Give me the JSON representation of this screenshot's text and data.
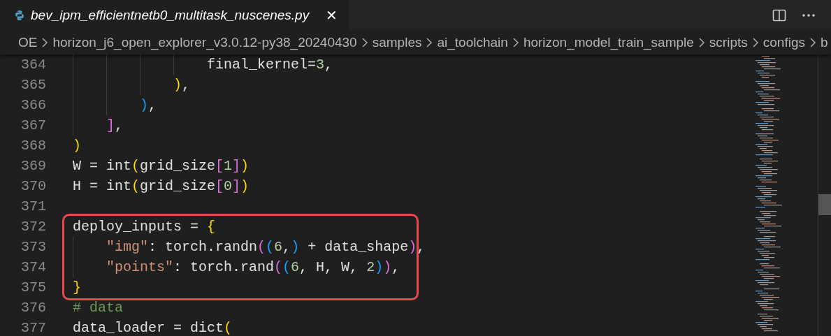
{
  "tab": {
    "title": "bev_ipm_efficientnetb0_multitask_nuscenes.py",
    "close": "✕",
    "selected": true
  },
  "breadcrumb": [
    "OE",
    "horizon_j6_open_explorer_v3.0.12-py38_20240430",
    "samples",
    "ai_toolchain",
    "horizon_model_train_sample",
    "scripts",
    "configs",
    "b"
  ],
  "code": {
    "sections": [
      {
        "kind": "plain",
        "lines": [
          {
            "number": "364",
            "tokens": [
              {
                "kind": "text",
                "text": "                final_kernel="
              },
              {
                "kind": "num",
                "text": "3"
              },
              {
                "kind": "text",
                "text": ","
              }
            ]
          },
          {
            "number": "365",
            "tokens": [
              {
                "kind": "b1",
                "text": "            )"
              },
              {
                "kind": "text",
                "text": ","
              }
            ]
          },
          {
            "number": "366",
            "tokens": [
              {
                "kind": "b3",
                "text": "        )"
              },
              {
                "kind": "text",
                "text": ","
              }
            ]
          },
          {
            "number": "367",
            "tokens": [
              {
                "kind": "b2",
                "text": "    ]"
              },
              {
                "kind": "text",
                "text": ","
              }
            ]
          },
          {
            "number": "368",
            "tokens": [
              {
                "kind": "b1",
                "text": ")"
              }
            ]
          },
          {
            "number": "369",
            "tokens": [
              {
                "kind": "text",
                "text": "W = int"
              },
              {
                "kind": "b1",
                "text": "("
              },
              {
                "kind": "text",
                "text": "grid_size"
              },
              {
                "kind": "b2",
                "text": "["
              },
              {
                "kind": "num",
                "text": "1"
              },
              {
                "kind": "b2",
                "text": "]"
              },
              {
                "kind": "b1",
                "text": ")"
              }
            ]
          },
          {
            "number": "370",
            "tokens": [
              {
                "kind": "text",
                "text": "H = int"
              },
              {
                "kind": "b1",
                "text": "("
              },
              {
                "kind": "text",
                "text": "grid_size"
              },
              {
                "kind": "b2",
                "text": "["
              },
              {
                "kind": "num",
                "text": "0"
              },
              {
                "kind": "b2",
                "text": "]"
              },
              {
                "kind": "b1",
                "text": ")"
              }
            ]
          },
          {
            "number": "371"
          }
        ]
      },
      {
        "kind": "highlighted",
        "lines": [
          {
            "number": "372",
            "tokens": [
              {
                "kind": "text",
                "text": "deploy_inputs = "
              },
              {
                "kind": "b1",
                "text": "{"
              }
            ]
          },
          {
            "number": "373",
            "tokens": [
              {
                "kind": "str",
                "text": "    \"img\""
              },
              {
                "kind": "text",
                "text": ": torch.randn"
              },
              {
                "kind": "b2",
                "text": "("
              },
              {
                "kind": "b3",
                "text": "("
              },
              {
                "kind": "num",
                "text": "6"
              },
              {
                "kind": "text",
                "text": ","
              },
              {
                "kind": "b3",
                "text": ")"
              },
              {
                "kind": "text",
                "text": " + data_shape"
              },
              {
                "kind": "b2",
                "text": ")"
              },
              {
                "kind": "text",
                "text": ","
              }
            ]
          },
          {
            "number": "374",
            "tokens": [
              {
                "kind": "str",
                "text": "    \"points\""
              },
              {
                "kind": "text",
                "text": ": torch.rand"
              },
              {
                "kind": "b2",
                "text": "("
              },
              {
                "kind": "b3",
                "text": "("
              },
              {
                "kind": "num",
                "text": "6"
              },
              {
                "kind": "text",
                "text": ", H, W, "
              },
              {
                "kind": "num",
                "text": "2"
              },
              {
                "kind": "b3",
                "text": ")"
              },
              {
                "kind": "b2",
                "text": ")"
              },
              {
                "kind": "text",
                "text": ","
              }
            ]
          },
          {
            "number": "375",
            "tokens": [
              {
                "kind": "b1",
                "text": "}"
              }
            ]
          }
        ]
      },
      {
        "kind": "plain",
        "lines": [
          {
            "number": "376",
            "tokens": [
              {
                "kind": "comment",
                "text": "# data"
              }
            ]
          },
          {
            "number": "377",
            "tokens": [
              {
                "kind": "text",
                "text": "data_loader = dict"
              },
              {
                "kind": "b1",
                "text": "("
              }
            ]
          }
        ]
      }
    ]
  }
}
